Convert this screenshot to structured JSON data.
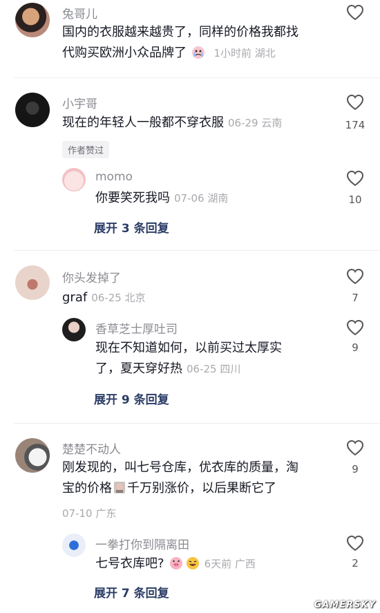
{
  "comments": [
    {
      "username": "兔哥儿",
      "line1": "国内的衣服越来越贵了，同样的价格我都找",
      "line2": "代购买欧洲小众品牌了",
      "meta": "1小时前 湖北",
      "likes": ""
    },
    {
      "username": "小宇哥",
      "text": "现在的年轻人一般都不穿衣服",
      "meta": "06-29 云南",
      "likes": "174",
      "badge": "作者赞过",
      "reply": {
        "username": "momo",
        "text": "你要笑死我吗",
        "meta": "07-06 湖南",
        "likes": "10"
      },
      "expand": "展开 3 条回复"
    },
    {
      "username": "你头发掉了",
      "text": "graf",
      "meta": "06-25 北京",
      "likes": "7",
      "reply": {
        "username": "香草芝士厚吐司",
        "line1": "现在不知道如何，以前买过太厚实",
        "line2": "了，夏天穿好热",
        "meta": "06-25 四川",
        "likes": "9"
      },
      "expand": "展开 9 条回复"
    },
    {
      "username": "楚楚不动人",
      "line1": "刚发现的，叫七号仓库，优衣库的质量，淘",
      "line2a": "宝的价格",
      "line2b": "千万别涨价，以后果断它了",
      "meta": "07-10 广东",
      "likes": "9",
      "reply": {
        "username": "一拳打你到隔离田",
        "text": "七号衣库吧?",
        "meta": "6天前 广西",
        "likes": "2"
      },
      "expand": "展开 7 条回复"
    }
  ],
  "watermark": "GAMERSKY",
  "colors": {
    "text": "#161823",
    "muted": "#8a8b91",
    "link": "#2b3c66"
  }
}
